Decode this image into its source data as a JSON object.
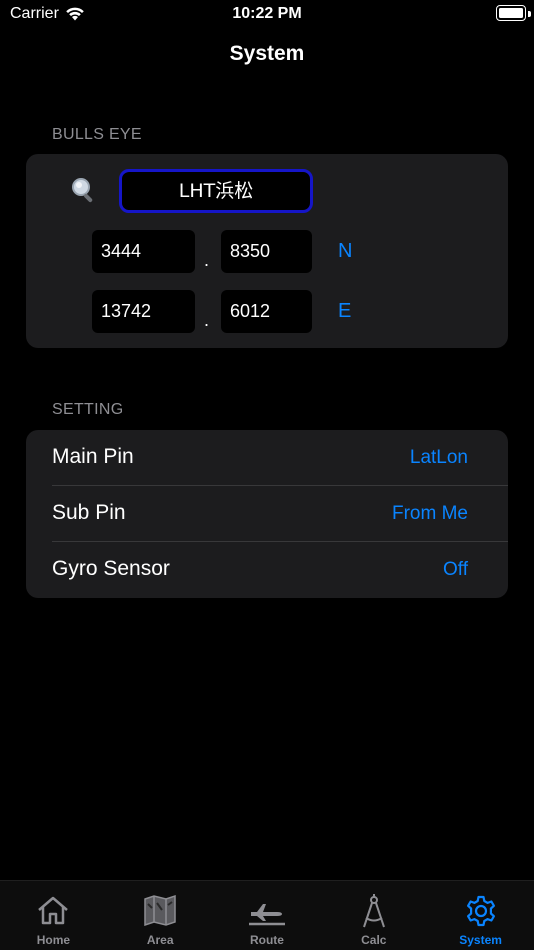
{
  "status_bar": {
    "carrier": "Carrier",
    "time": "10:22 PM",
    "battery_level": 1.0
  },
  "nav": {
    "title": "System"
  },
  "bulls_eye": {
    "header": "BULLS EYE",
    "name": "LHT浜松",
    "separator": ".",
    "lat_int": "3444",
    "lat_dec": "8350",
    "lat_dir": "N",
    "lon_int": "13742",
    "lon_dec": "6012",
    "lon_dir": "E"
  },
  "setting": {
    "header": "SETTING",
    "rows": [
      {
        "label": "Main Pin",
        "value": "LatLon"
      },
      {
        "label": "Sub Pin",
        "value": "From Me"
      },
      {
        "label": "Gyro Sensor",
        "value": "Off"
      }
    ]
  },
  "tabs": [
    {
      "label": "Home",
      "icon": "home-icon"
    },
    {
      "label": "Area",
      "icon": "map-icon"
    },
    {
      "label": "Route",
      "icon": "airplane-icon"
    },
    {
      "label": "Calc",
      "icon": "compass-icon"
    },
    {
      "label": "System",
      "icon": "gear-icon",
      "active": true
    }
  ],
  "colors": {
    "accent": "#0a84ff",
    "card": "#1c1c1e",
    "field_border": "#1515c8",
    "secondary_text": "#8e8e93"
  }
}
